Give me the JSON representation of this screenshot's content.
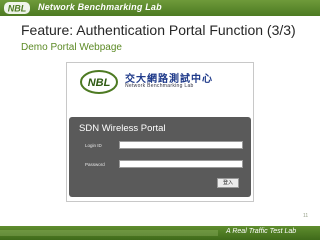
{
  "header": {
    "lab_name": "Network Benchmarking Lab",
    "logo_text": "NBL"
  },
  "slide": {
    "title": "Feature: Authentication Portal Function (3/3)",
    "subtitle": "Demo Portal Webpage",
    "page_number": "11"
  },
  "screenshot": {
    "brand_logo_text": "NBL",
    "brand_chinese": "交大網路測試中心",
    "brand_english": "Network Benchmarking Lab",
    "portal": {
      "title": "SDN Wireless Portal",
      "login_id_label": "Login ID",
      "password_label": "Password",
      "login_id_value": "",
      "password_value": "",
      "login_button": "登入"
    }
  },
  "footer": {
    "tagline": "A Real Traffic Test Lab"
  },
  "colors": {
    "green": "#5c8a25",
    "portal_bg": "#5a5a5a",
    "brand_blue": "#1f3a8a"
  }
}
